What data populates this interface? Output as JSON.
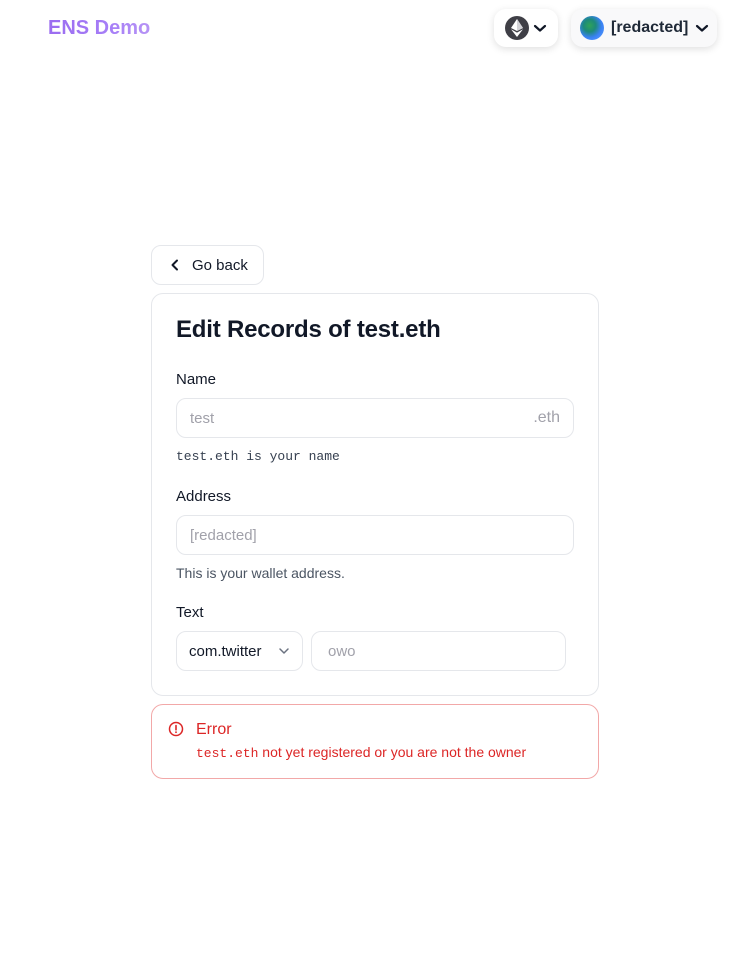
{
  "header": {
    "brand": "ENS Demo",
    "chain_icon": "ethereum-icon",
    "account_label": "[redacted]"
  },
  "back_button": {
    "label": "Go back",
    "icon": "chevron-left-icon"
  },
  "form": {
    "title": "Edit Records of test.eth",
    "name": {
      "label": "Name",
      "placeholder": "test",
      "suffix": ".eth",
      "helper": "test.eth is your name"
    },
    "address": {
      "label": "Address",
      "placeholder": "[redacted]",
      "helper": "This is your wallet address."
    },
    "text": {
      "label": "Text",
      "key_selected": "com.twitter",
      "value_placeholder": "owo"
    }
  },
  "alert": {
    "icon": "alert-circle-icon",
    "title": "Error",
    "message_code": "test.eth",
    "message_text": " not yet registered or you are not the owner"
  },
  "colors": {
    "brand_gradient_start": "#9b6cf0",
    "error": "#dc2626",
    "error_border": "#f2a8a8",
    "border": "#e5e7eb"
  }
}
